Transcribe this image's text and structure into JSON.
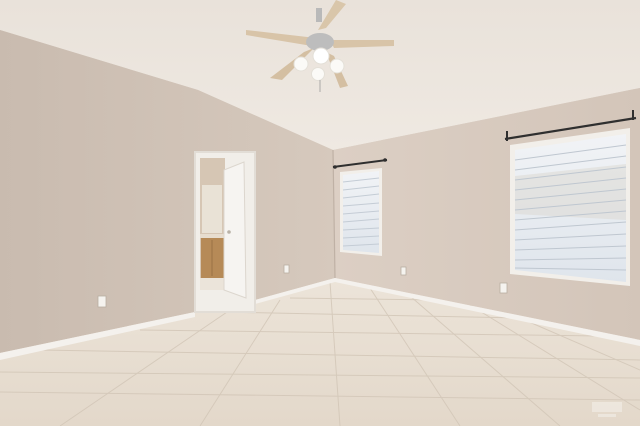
{
  "scene": {
    "kind": "empty-room-interior",
    "description_visible_text": []
  },
  "colors": {
    "wall_left": "#cdbfb3",
    "wall_right": "#d8cbbf",
    "ceiling": "#ece6df",
    "floor": "#e6ddd0",
    "baseboard": "#f3f0ec",
    "window_light": "#e9eef3",
    "blind_slat": "#c7ced6",
    "door_frame": "#f2efea",
    "cabinet": "#b78c5a",
    "fan_blade": "#d8c4a8",
    "fan_metal": "#bdbdbd"
  }
}
